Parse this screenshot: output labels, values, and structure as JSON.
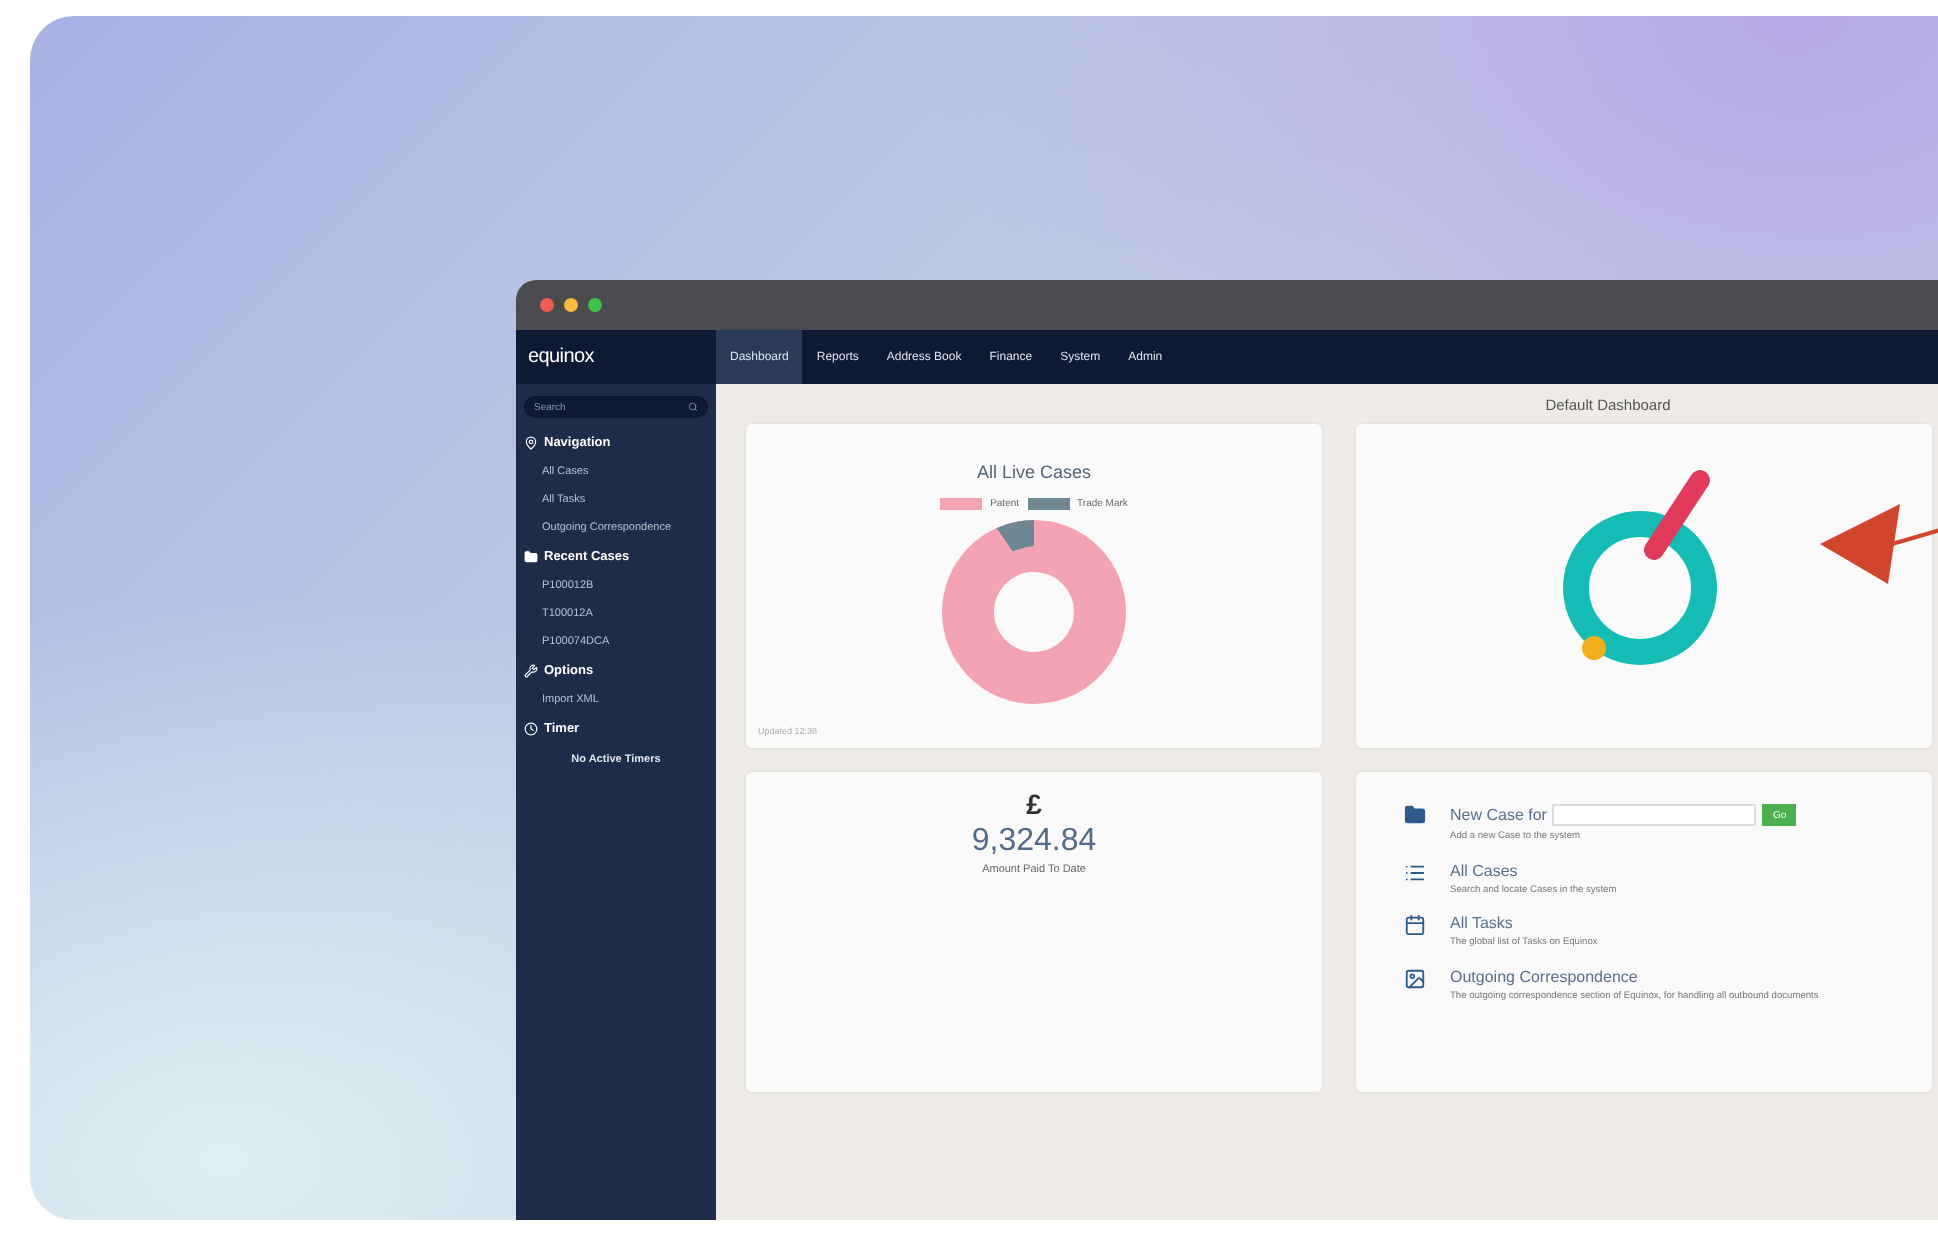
{
  "window": {
    "dots": [
      {
        "color": "#ee5b52"
      },
      {
        "color": "#f2bd3a"
      },
      {
        "color": "#3fc14c"
      }
    ]
  },
  "app": {
    "logo": "equinox"
  },
  "nav_tabs": [
    {
      "label": "Dashboard",
      "selected": true
    },
    {
      "label": "Reports",
      "selected": false
    },
    {
      "label": "Address Book",
      "selected": false
    },
    {
      "label": "Finance",
      "selected": false
    },
    {
      "label": "System",
      "selected": false
    },
    {
      "label": "Admin",
      "selected": false
    }
  ],
  "sidebar": {
    "search": {
      "placeholder": "Search"
    },
    "sections": [
      {
        "kind": "pin",
        "title": "Navigation",
        "items": [
          "All Cases",
          "All Tasks",
          "Outgoing Correspondence"
        ]
      },
      {
        "kind": "folder",
        "title": "Recent Cases",
        "items": [
          "P100012B",
          "T100012A",
          "P100074DCA"
        ]
      },
      {
        "kind": "tools",
        "title": "Options",
        "items": [
          "Import XML"
        ]
      },
      {
        "kind": "clock",
        "title": "Timer",
        "note": "No Active Timers"
      }
    ]
  },
  "dashboard_title": "Default Dashboard",
  "live_cases": {
    "title": "All Live Cases",
    "legend": [
      {
        "label": "Patent",
        "color": "#f4a3b3"
      },
      {
        "label": "Trade Mark",
        "color": "#6f8792"
      }
    ],
    "footnote": "Updated 12:38"
  },
  "amount": {
    "symbol": "£",
    "value": "9,324.84",
    "label": "Amount Paid To Date"
  },
  "quick_links": [
    {
      "kind": "new_case",
      "title": "New Case for",
      "button": "Go",
      "description": "Add a new Case to the system"
    },
    {
      "kind": "cases",
      "title": "All Cases",
      "description": "Search and locate Cases in the system"
    },
    {
      "kind": "tasks",
      "title": "All Tasks",
      "description": "The global list of Tasks on Equinox"
    },
    {
      "kind": "correspondence",
      "title": "Outgoing Correspondence",
      "description": "The outgoing correspondence section of Equinox, for handling all outbound documents"
    }
  ]
}
